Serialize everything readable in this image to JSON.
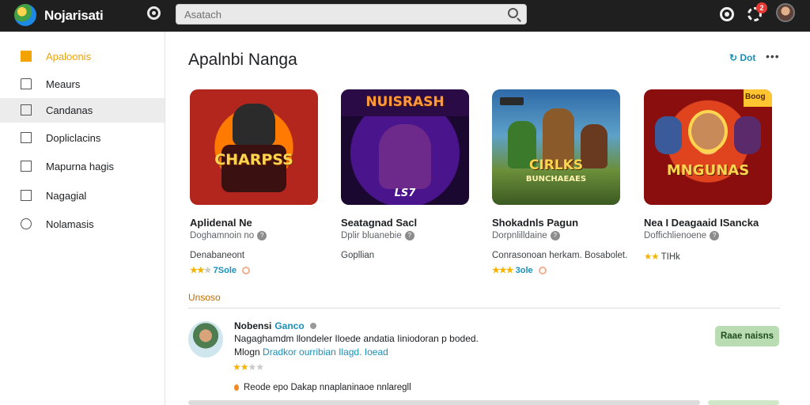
{
  "header": {
    "app_title": "Nojarisati",
    "search_placeholder": "Asatach",
    "notification_count": "2"
  },
  "sidebar": {
    "items": [
      {
        "label": "Apaloonis",
        "icon": "folder-icon",
        "selected": true
      },
      {
        "label": "Meaurs",
        "icon": "home-icon",
        "selected": false
      },
      {
        "label": "Candanas",
        "icon": "image-icon",
        "selected": false
      },
      {
        "label": "Dopliclacins",
        "icon": "checkbox-icon",
        "selected": false
      },
      {
        "label": "Mapurna hagis",
        "icon": "square-icon",
        "selected": false
      },
      {
        "label": "Nagagial",
        "icon": "square-outline-icon",
        "selected": false
      },
      {
        "label": "Nolamasis",
        "icon": "globe-icon",
        "selected": false
      }
    ]
  },
  "main": {
    "title": "Apalnbi Nanga",
    "more_link": "Dot",
    "cards": [
      {
        "thumb_text": "CHARPSS",
        "title": "Aplidenal Ne",
        "developer": "Doghamnoin no",
        "description": "Denabaneont",
        "stars": 2,
        "rating_text": "7Sole"
      },
      {
        "thumb_text": "NUISRASH",
        "thumb_sub": "LS7",
        "title": "Seatagnad Sacl",
        "developer": "Dplir bluanebie",
        "description": "Gopllian",
        "stars": 0,
        "rating_text": ""
      },
      {
        "thumb_text": "CIRLKS",
        "thumb_sub": "BUNCHAEAES",
        "title": "Shokadnls Pagun",
        "developer": "Dorpnlilldaine",
        "description": "Conrasonoan herkam. Bosabolet.",
        "stars": 3,
        "rating_text": "3ole"
      },
      {
        "thumb_text": "MNGUNAS",
        "thumb_badge": "Boog",
        "title": "Nea I Deagaaid ISancka",
        "developer": "Doffichlienoene",
        "description": "",
        "stars": 2,
        "rating_text": "TIHk"
      }
    ]
  },
  "section": {
    "label": "Unsoso"
  },
  "review": {
    "name": "Nobensi",
    "tag": "Ganco",
    "line1": "Nagaghamdm llondeler Iloede andatia Iiniodoran p boded.",
    "line2_prefix": "Mlogn",
    "line2_link": "Dradkor ourribian Ilagd. Ioead",
    "stars": 2,
    "note": "Reode epo Dakap nnaplaninaoe nnlaregll",
    "action_label": "Raae naisns"
  },
  "colors": {
    "accent_yellow": "#f2a300",
    "link_blue": "#1a8fb8",
    "topbar": "#1f1f1f",
    "action_green": "#b9dcb2"
  }
}
